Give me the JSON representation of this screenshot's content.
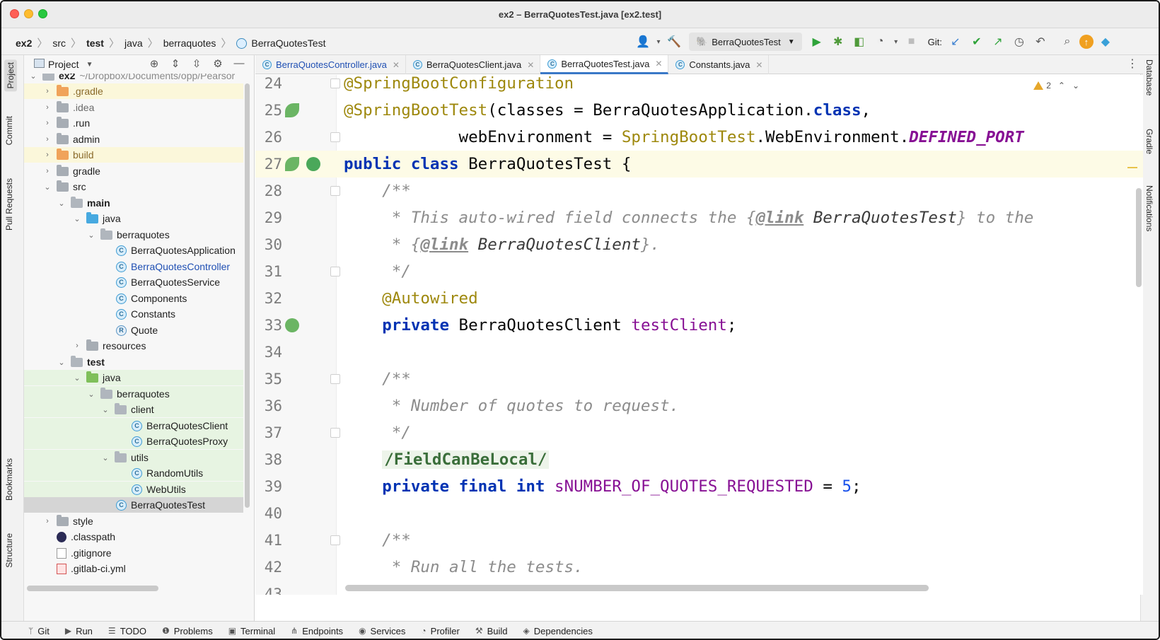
{
  "window": {
    "title": "ex2 – BerraQuotesTest.java [ex2.test]"
  },
  "breadcrumb": [
    "ex2",
    "src",
    "test",
    "java",
    "berraquotes",
    "BerraQuotesTest"
  ],
  "toolbar": {
    "run_config": "BerraQuotesTest",
    "git_label": "Git:"
  },
  "left_tabs": {
    "project": "Project",
    "commit": "Commit",
    "pull_requests": "Pull Requests",
    "bookmarks": "Bookmarks",
    "structure": "Structure"
  },
  "right_tabs": {
    "database": "Database",
    "gradle": "Gradle",
    "notifications": "Notifications"
  },
  "project_panel": {
    "title": "Project",
    "root_name": "ex2",
    "root_path": "~/Dropbox/Documents/opp/Pearsor",
    "items": [
      ".gradle",
      ".idea",
      ".run",
      "admin",
      "build",
      "gradle",
      "src",
      "main",
      "java",
      "berraquotes",
      "BerraQuotesApplication",
      "BerraQuotesController",
      "BerraQuotesService",
      "Components",
      "Constants",
      "Quote",
      "resources",
      "test",
      "java",
      "berraquotes",
      "client",
      "BerraQuotesClient",
      "BerraQuotesProxy",
      "utils",
      "RandomUtils",
      "WebUtils",
      "BerraQuotesTest",
      "style",
      ".classpath",
      ".gitignore",
      ".gitlab-ci.yml"
    ]
  },
  "tabs": [
    {
      "label": "BerraQuotesController.java"
    },
    {
      "label": "BerraQuotesClient.java"
    },
    {
      "label": "BerraQuotesTest.java"
    },
    {
      "label": "Constants.java"
    }
  ],
  "editor": {
    "warning_count": "2",
    "line_numbers": [
      "24",
      "25",
      "26",
      "27",
      "28",
      "29",
      "30",
      "31",
      "32",
      "33",
      "34",
      "35",
      "36",
      "37",
      "38",
      "39",
      "40",
      "41",
      "42",
      "43"
    ],
    "tokens": {
      "ann_springbootconfig": "@SpringBootConfiguration",
      "ann_springboottest": "@SpringBootTest",
      "l25_rest1": "(classes = BerraQuotesApplication.",
      "kw_class": "class",
      "comma": ",",
      "l26_indent": "            webEnvironment = ",
      "l26_ann_ref": "SpringBootTest",
      "l26_mid": ".WebEnvironment.",
      "l26_const": "DEFINED_PORT",
      "kw_public": "public",
      "kw_class2": "class",
      "l27_name": " BerraQuotesTest {",
      "c_open": "    /**",
      "c29_a": "     * This auto-wired field connects the {",
      "c29_link": "@link",
      "c29_ref": " BerraQuotesTest",
      "c29_b": "} to the",
      "c30_a": "     * {",
      "c30_link": "@link",
      "c30_ref": " BerraQuotesClient",
      "c30_b": "}.",
      "c_close": "     */",
      "ann_autowired": "    @Autowired",
      "kw_private": "private",
      "l33_type": " BerraQuotesClient ",
      "l33_field": "testClient",
      "semicolon": ";",
      "c36": "     * Number of quotes to request.",
      "suppress": "/FieldCanBeLocal/",
      "kw_private2": "private",
      "kw_final": "final",
      "kw_int": "int",
      "l39_field": "sNUMBER_OF_QUOTES_REQUESTED",
      "l39_eq": " = ",
      "l39_num": "5",
      "c42": "     * Run all the tests."
    }
  },
  "bottom_bar": [
    "Git",
    "Run",
    "TODO",
    "Problems",
    "Terminal",
    "Endpoints",
    "Services",
    "Profiler",
    "Build",
    "Dependencies"
  ]
}
